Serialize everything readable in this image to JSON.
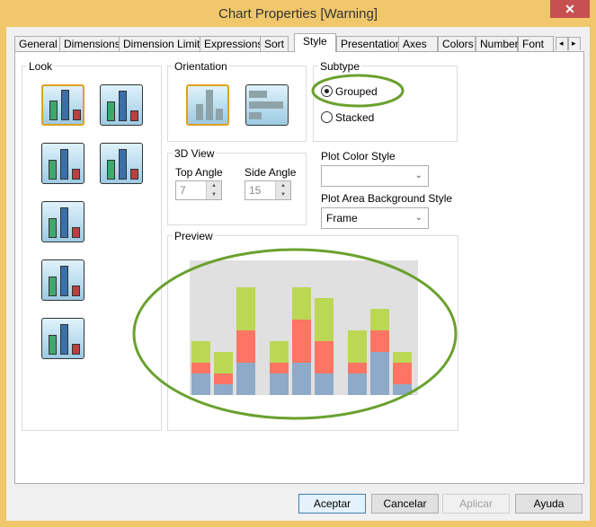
{
  "window": {
    "title": "Chart Properties [Warning]",
    "close_glyph": "✕"
  },
  "tabs": [
    {
      "label": "General"
    },
    {
      "label": "Dimensions"
    },
    {
      "label": "Dimension Limits"
    },
    {
      "label": "Expressions"
    },
    {
      "label": "Sort"
    },
    {
      "label": "Style",
      "selected": true
    },
    {
      "label": "Presentation"
    },
    {
      "label": "Axes"
    },
    {
      "label": "Colors"
    },
    {
      "label": "Number"
    },
    {
      "label": "Font"
    }
  ],
  "tab_scroll": {
    "left": "◂",
    "right": "▸"
  },
  "look": {
    "label": "Look",
    "selected_index": 0
  },
  "orientation": {
    "label": "Orientation",
    "selected": "vertical"
  },
  "subtype": {
    "label": "Subtype",
    "options": [
      {
        "label": "Grouped",
        "checked": true
      },
      {
        "label": "Stacked",
        "checked": false
      }
    ]
  },
  "view3d": {
    "label": "3D View",
    "top_angle_label": "Top Angle",
    "top_angle": "7",
    "side_angle_label": "Side Angle",
    "side_angle": "15"
  },
  "plot_color_style": {
    "label": "Plot Color Style",
    "value": ""
  },
  "plot_area_bg": {
    "label": "Plot Area Background Style",
    "value": "Frame"
  },
  "preview": {
    "label": "Preview",
    "colors": {
      "blue": "#8eaac9",
      "red": "#fe7564",
      "green": "#bcd754",
      "bg": "#e0e0e0"
    },
    "bars": [
      [
        2,
        1,
        2
      ],
      [
        1,
        1,
        2
      ],
      [
        3,
        3,
        4
      ],
      [
        2,
        1,
        2
      ],
      [
        3,
        4,
        3
      ],
      [
        2,
        3,
        4
      ],
      [
        2,
        1,
        3
      ],
      [
        4,
        2,
        2
      ],
      [
        1,
        2,
        1
      ]
    ]
  },
  "annotation_color": "#6aa12e",
  "buttons": {
    "ok": "Aceptar",
    "cancel": "Cancelar",
    "apply": "Aplicar",
    "help": "Ayuda"
  }
}
